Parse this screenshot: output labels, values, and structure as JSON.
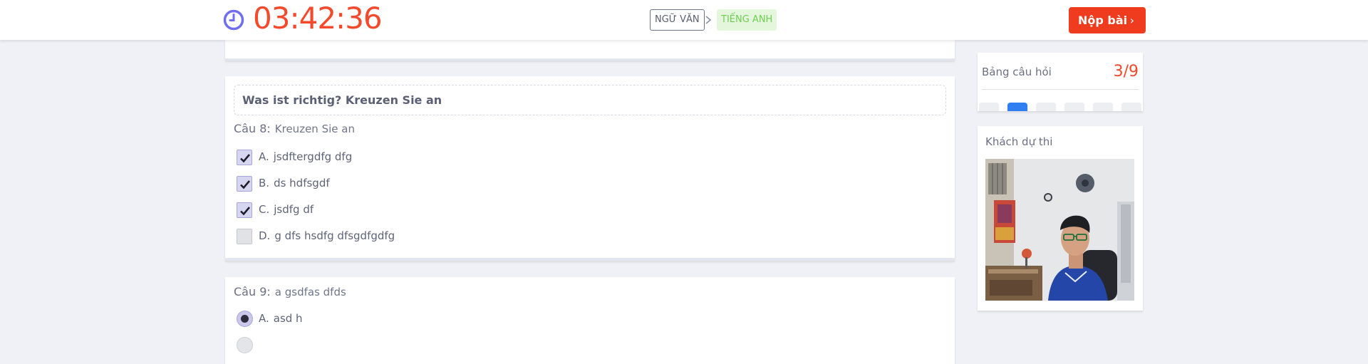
{
  "header": {
    "timer": "03:42:36",
    "subject_current": "NGỮ VĂN",
    "subject_next": "TIẾNG ANH",
    "submit_label": "Nộp bài",
    "submit_arrow": "›"
  },
  "question8": {
    "instruction": "Was ist richtig? Kreuzen Sie an",
    "number": "Câu 8:",
    "text": "Kreuzen Sie an",
    "options": [
      {
        "letter": "A.",
        "text": "jsdftergdfg dfg",
        "checked": true
      },
      {
        "letter": "B.",
        "text": "ds hdfsgdf",
        "checked": true
      },
      {
        "letter": "C.",
        "text": "jsdfg df",
        "checked": true
      },
      {
        "letter": "D.",
        "text": "g dfs hsdfg dfsgdfgdfg",
        "checked": false
      }
    ]
  },
  "question9": {
    "number": "Câu 9:",
    "text": "a gsdfas dfds",
    "options": [
      {
        "letter": "A.",
        "text": "asd h",
        "selected": true
      }
    ]
  },
  "sidebar": {
    "question_board_label": "Bảng câu hỏi",
    "question_board_count": "3/9",
    "guest_label": "Khách dự thi"
  },
  "colors": {
    "accent_red": "#f03c1e",
    "timer_red": "#f4492b",
    "clock_purple": "#6f6ff0",
    "active_chip_blue": "#2f7ff2",
    "tag_green": "#6fcf52"
  }
}
